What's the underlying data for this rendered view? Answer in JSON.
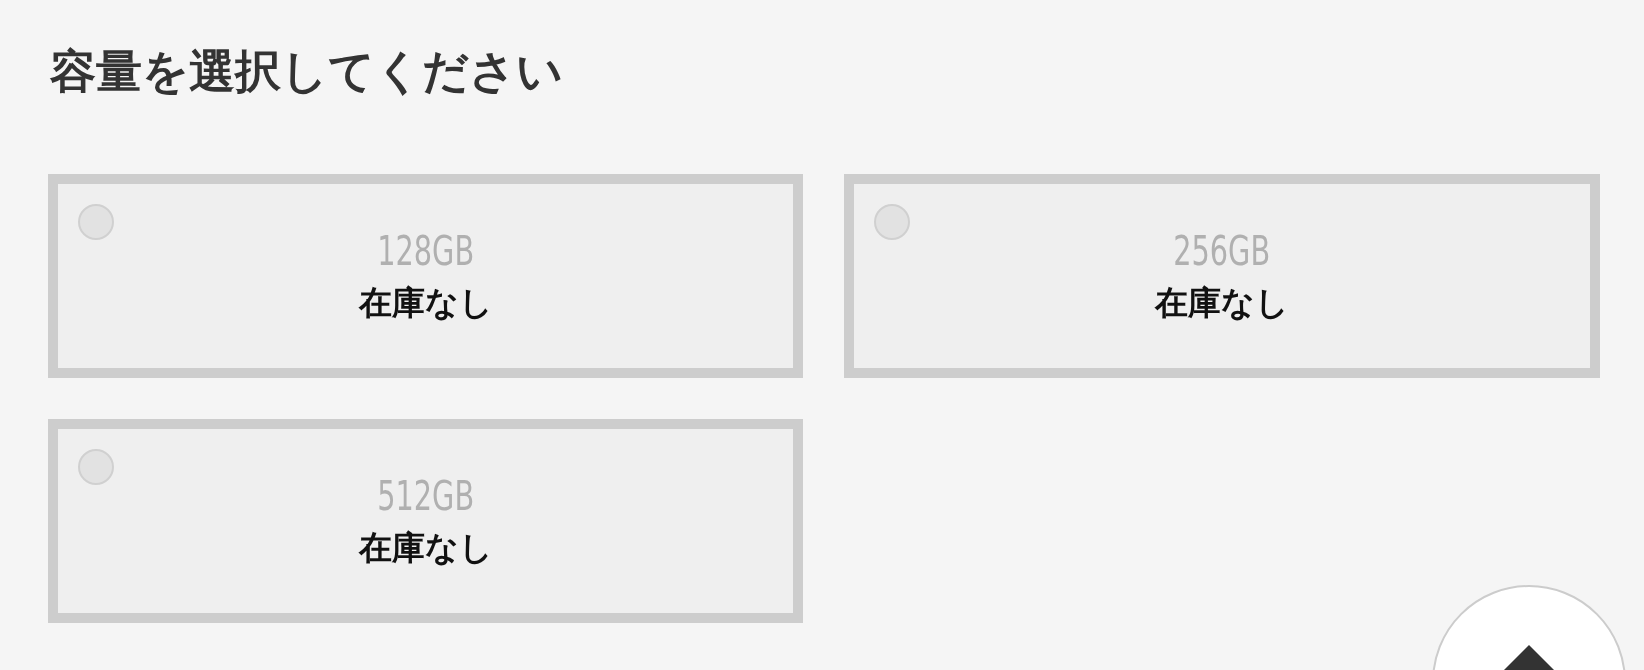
{
  "heading": "容量を選択してください",
  "options": [
    {
      "capacity": "128GB",
      "stock": "在庫なし",
      "selected": false,
      "disabled": true
    },
    {
      "capacity": "256GB",
      "stock": "在庫なし",
      "selected": false,
      "disabled": true
    },
    {
      "capacity": "512GB",
      "stock": "在庫なし",
      "selected": false,
      "disabled": true
    }
  ]
}
